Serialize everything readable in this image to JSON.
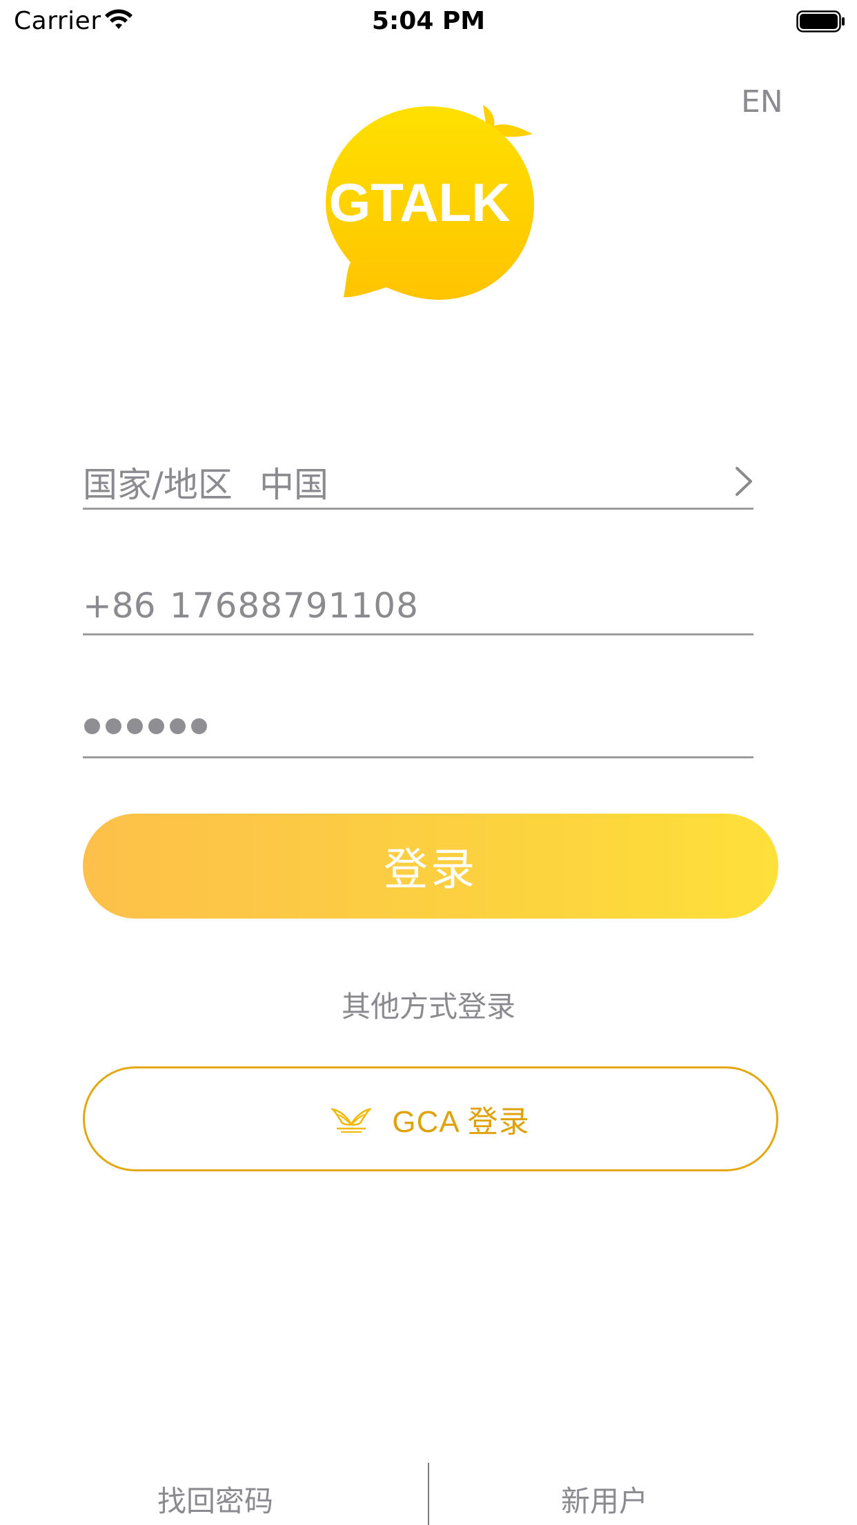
{
  "status_bar": {
    "carrier": "Carrier",
    "time": "5:04 PM",
    "wifi_icon": "wifi-icon",
    "battery_icon": "battery-full-icon"
  },
  "header": {
    "lang_switch": "EN"
  },
  "logo": {
    "text": "GTALK",
    "color_top": "#FFE000",
    "color_bottom": "#FFC400"
  },
  "form": {
    "country_label": "国家/地区",
    "country_value": "中国",
    "phone_code": "+86",
    "phone_number": "17688791108",
    "password_length": 6
  },
  "login_button": {
    "label": "登录",
    "gradient_start": "#FDC04A",
    "gradient_end": "#FEE03A"
  },
  "other_login_text": "其他方式登录",
  "gca_button": {
    "label": "GCA 登录",
    "icon": "gca-wings-icon",
    "accent_color": "#E0A20A"
  },
  "footer": {
    "forgot_password": "找回密码",
    "new_user": "新用户"
  }
}
